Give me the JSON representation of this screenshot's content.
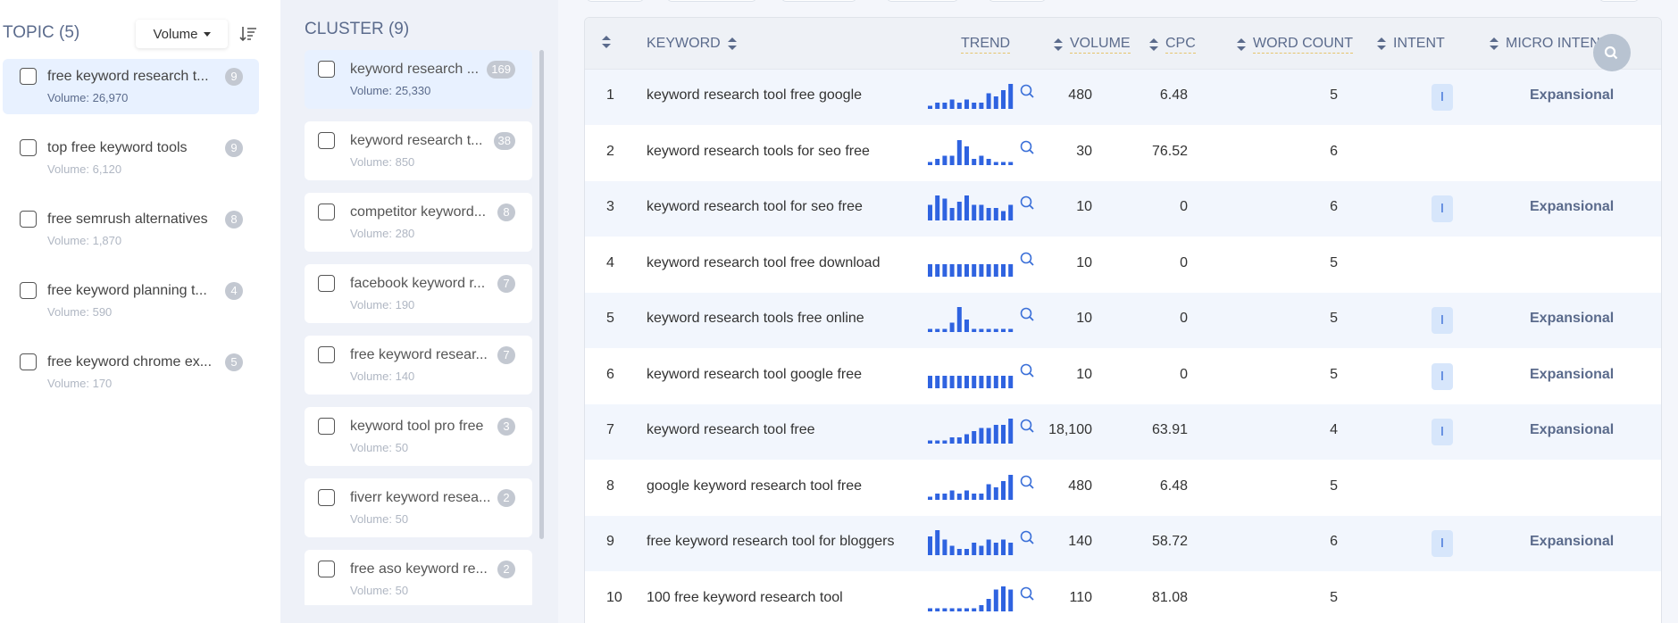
{
  "topic": {
    "title": "TOPIC (5)",
    "sort_label": "Volume",
    "items": [
      {
        "label": "free keyword research t...",
        "volume": "Volume: 26,970",
        "count": "9",
        "active": true
      },
      {
        "label": "top free keyword tools",
        "volume": "Volume: 6,120",
        "count": "9"
      },
      {
        "label": "free semrush alternatives",
        "volume": "Volume: 1,870",
        "count": "8"
      },
      {
        "label": "free keyword planning t...",
        "volume": "Volume: 590",
        "count": "4"
      },
      {
        "label": "free keyword chrome ex...",
        "volume": "Volume: 170",
        "count": "5"
      }
    ]
  },
  "cluster": {
    "title": "CLUSTER (9)",
    "items": [
      {
        "label": "keyword research ...",
        "volume": "Volume: 25,330",
        "count": "169",
        "active": true
      },
      {
        "label": "keyword research t...",
        "volume": "Volume: 850",
        "count": "38"
      },
      {
        "label": "competitor keyword...",
        "volume": "Volume: 280",
        "count": "8"
      },
      {
        "label": "facebook keyword r...",
        "volume": "Volume: 190",
        "count": "7"
      },
      {
        "label": "free keyword resear...",
        "volume": "Volume: 140",
        "count": "7"
      },
      {
        "label": "keyword tool pro free",
        "volume": "Volume: 50",
        "count": "3"
      },
      {
        "label": "fiverr keyword resea...",
        "volume": "Volume: 50",
        "count": "2"
      },
      {
        "label": "free aso keyword re...",
        "volume": "Volume: 50",
        "count": "2"
      }
    ]
  },
  "table": {
    "headers": {
      "keyword": "KEYWORD",
      "trend": "TREND",
      "volume": "VOLUME",
      "cpc": "CPC",
      "word_count": "WORD COUNT",
      "intent": "INTENT",
      "micro_intent": "MICRO INTENT"
    },
    "rows": [
      {
        "num": "1",
        "keyword": "keyword research tool free google",
        "trend": [
          1,
          2,
          2,
          3,
          2,
          3,
          2,
          2,
          5,
          4,
          6,
          8
        ],
        "volume": "480",
        "cpc": "6.48",
        "word_count": "5",
        "intent": "I",
        "micro": "Expansional"
      },
      {
        "num": "2",
        "keyword": "keyword research tools for seo free",
        "trend": [
          1,
          2,
          3,
          3,
          8,
          6,
          2,
          3,
          2,
          1,
          1,
          1
        ],
        "volume": "30",
        "cpc": "76.52",
        "word_count": "6",
        "intent": "",
        "micro": ""
      },
      {
        "num": "3",
        "keyword": "keyword research tool for seo free",
        "trend": [
          5,
          8,
          7,
          4,
          6,
          8,
          5,
          5,
          4,
          4,
          3,
          5
        ],
        "volume": "10",
        "cpc": "0",
        "word_count": "6",
        "intent": "I",
        "micro": "Expansional"
      },
      {
        "num": "4",
        "keyword": "keyword research tool free download",
        "trend": [
          4,
          4,
          4,
          4,
          4,
          4,
          4,
          4,
          4,
          4,
          4,
          4
        ],
        "volume": "10",
        "cpc": "0",
        "word_count": "5",
        "intent": "",
        "micro": ""
      },
      {
        "num": "5",
        "keyword": "keyword research tools free online",
        "trend": [
          1,
          1,
          1,
          3,
          8,
          4,
          1,
          1,
          1,
          1,
          1,
          1
        ],
        "volume": "10",
        "cpc": "0",
        "word_count": "5",
        "intent": "I",
        "micro": "Expansional"
      },
      {
        "num": "6",
        "keyword": "keyword research tool google free",
        "trend": [
          4,
          4,
          4,
          4,
          4,
          4,
          4,
          4,
          4,
          4,
          4,
          4
        ],
        "volume": "10",
        "cpc": "0",
        "word_count": "5",
        "intent": "I",
        "micro": "Expansional"
      },
      {
        "num": "7",
        "keyword": "keyword research tool free",
        "trend": [
          1,
          1,
          1,
          2,
          2,
          3,
          4,
          5,
          5,
          6,
          6,
          8
        ],
        "volume": "18,100",
        "cpc": "63.91",
        "word_count": "4",
        "intent": "I",
        "micro": "Expansional"
      },
      {
        "num": "8",
        "keyword": "google keyword research tool free",
        "trend": [
          1,
          2,
          2,
          3,
          2,
          3,
          2,
          2,
          5,
          4,
          6,
          8
        ],
        "volume": "480",
        "cpc": "6.48",
        "word_count": "5",
        "intent": "",
        "micro": ""
      },
      {
        "num": "9",
        "keyword": "free keyword research tool for bloggers",
        "trend": [
          6,
          8,
          5,
          3,
          2,
          2,
          4,
          3,
          5,
          4,
          5,
          4
        ],
        "volume": "140",
        "cpc": "58.72",
        "word_count": "6",
        "intent": "I",
        "micro": "Expansional"
      },
      {
        "num": "10",
        "keyword": "100 free keyword research tool",
        "trend": [
          1,
          1,
          1,
          1,
          1,
          1,
          1,
          2,
          4,
          7,
          8,
          7
        ],
        "volume": "110",
        "cpc": "81.08",
        "word_count": "5",
        "intent": "",
        "micro": ""
      }
    ]
  },
  "colors": {
    "accent": "#3a6fd8",
    "trend_bar": "#2f63e0",
    "badge": "#c3c8d1",
    "header_text": "#5b6b8c"
  },
  "icons": {
    "sort": "sort-descending-icon",
    "search": "magnifier-icon",
    "sorter": "sort-arrows-icon",
    "zoom": "zoom-icon"
  }
}
